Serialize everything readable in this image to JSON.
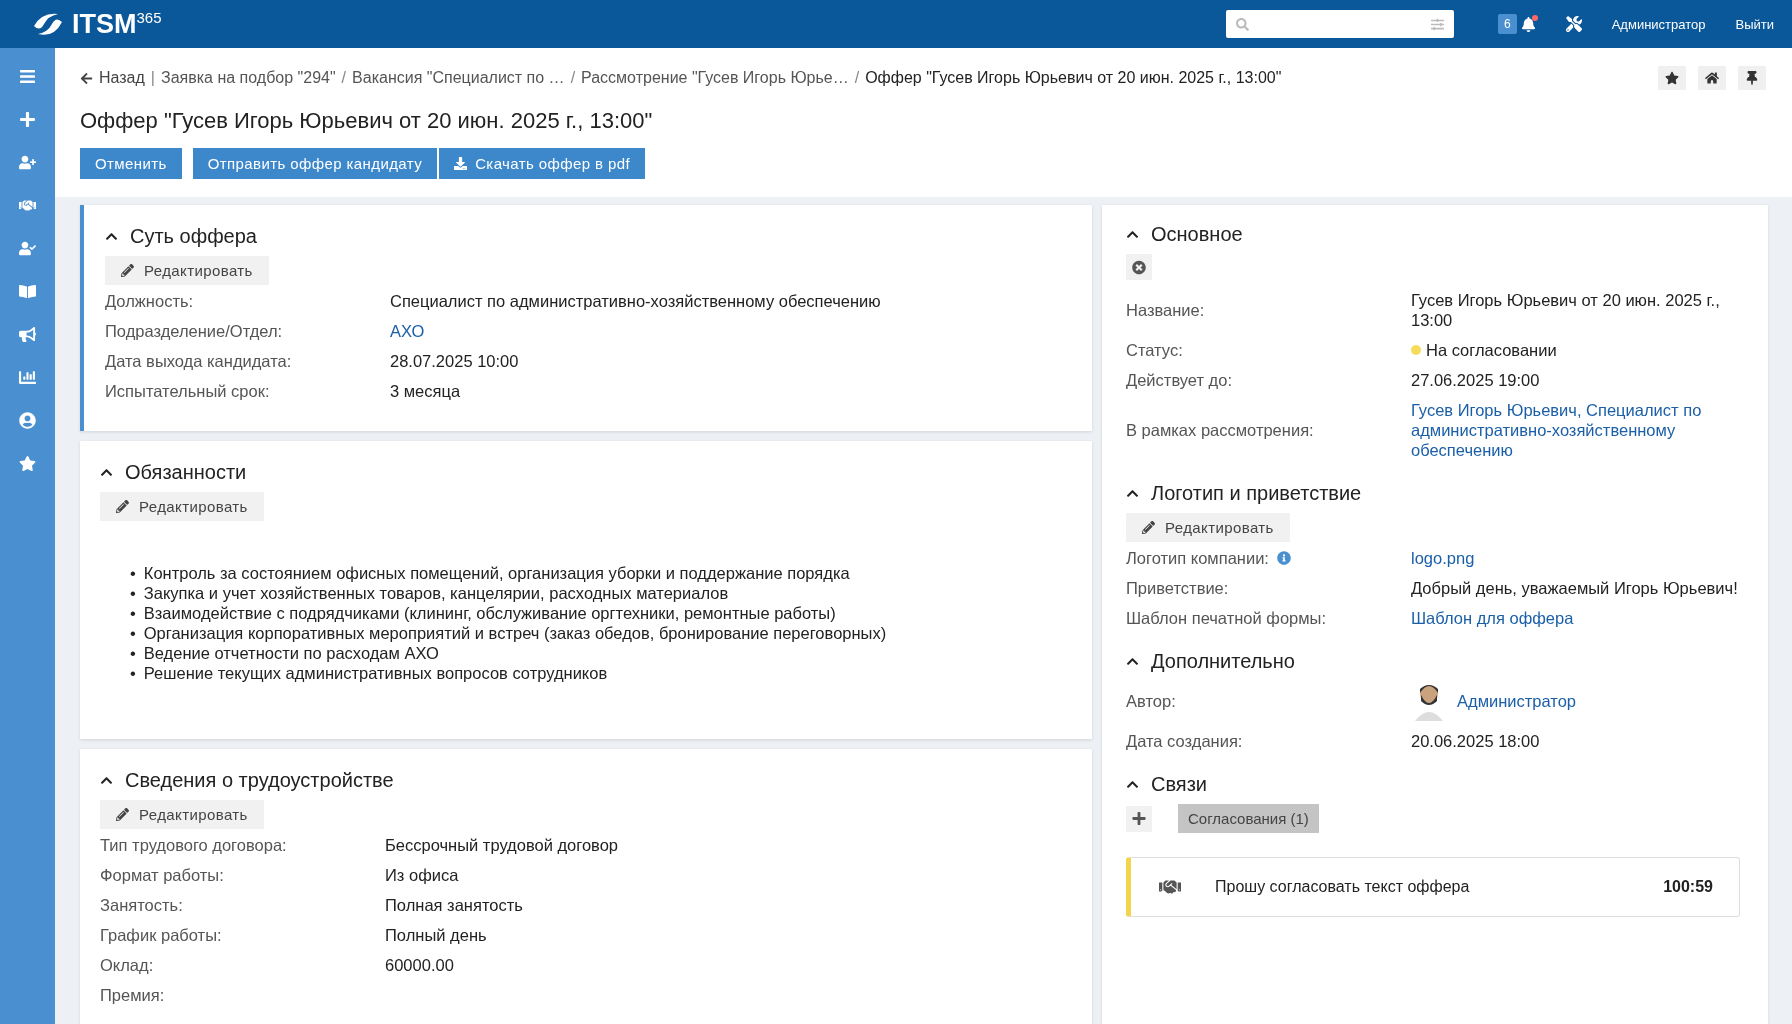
{
  "header": {
    "logo": "ITSM",
    "logo_sup": "365",
    "notifications": "6",
    "user": "Администратор",
    "logout": "Выйти"
  },
  "breadcrumbs": {
    "back": "Назад",
    "divider": "|",
    "separator": "/",
    "items": [
      "Заявка на подбор \"294\"",
      "Вакансия \"Специалист по …",
      "Рассмотрение \"Гусев Игорь Юрье…",
      "Оффер \"Гусев Игорь Юрьевич от 20 июн. 2025 г., 13:00\""
    ]
  },
  "title": "Оффер \"Гусев Игорь Юрьевич от 20 июн. 2025 г., 13:00\"",
  "actions": [
    {
      "label": "Отменить",
      "kind": "plain"
    },
    {
      "label": "Отправить оффер кандидату",
      "kind": "plain"
    },
    {
      "label": "Скачать оффер в pdf",
      "kind": "download"
    }
  ],
  "left_sections": [
    {
      "title": "Суть оффера",
      "active": true,
      "edit": "Редактировать",
      "fields": [
        {
          "label": "Должность:",
          "value": "Специалист по административно-хозяйственному обеспечению",
          "kind": "text"
        },
        {
          "label": "Подразделение/Отдел:",
          "value": "АХО",
          "kind": "link"
        },
        {
          "label": "Дата выхода кандидата:",
          "value": "28.07.2025 10:00",
          "kind": "text"
        },
        {
          "label": "Испытательный срок:",
          "value": "3 месяца",
          "kind": "text"
        }
      ]
    },
    {
      "title": "Обязанности",
      "active": false,
      "edit": "Редактировать",
      "bullet": "•",
      "bullets": [
        "Контроль за состоянием офисных помещений, организация уборки и поддержание порядка",
        "Закупка и учет хозяйственных товаров, канцелярии, расходных материалов",
        "Взаимодействие с подрядчиками (клининг, обслуживание оргтехники, ремонтные работы)",
        "Организация корпоративных мероприятий и встреч (заказ обедов, бронирование переговорных)",
        "Ведение отчетности по расходам АХО",
        "Решение текущих административных вопросов сотрудников"
      ]
    },
    {
      "title": "Сведения о трудоустройстве",
      "active": false,
      "edit": "Редактировать",
      "fields": [
        {
          "label": "Тип трудового договора:",
          "value": "Бессрочный трудовой договор",
          "kind": "text"
        },
        {
          "label": "Формат работы:",
          "value": "Из офиса",
          "kind": "text"
        },
        {
          "label": "Занятость:",
          "value": "Полная занятость",
          "kind": "text"
        },
        {
          "label": "График работы:",
          "value": "Полный день",
          "kind": "text"
        },
        {
          "label": "Оклад:",
          "value": "60000.00",
          "kind": "text"
        },
        {
          "label": "Премия:"
        }
      ]
    }
  ],
  "right_sections": [
    {
      "title": "Основное",
      "cancel_button": true,
      "fields": [
        {
          "label": "Название:",
          "value": "Гусев Игорь Юрьевич от 20 июн. 2025 г., 13:00",
          "kind": "text"
        },
        {
          "label": "Статус:",
          "value": "На согласовании",
          "kind": "status",
          "color": "#f7dc5c"
        },
        {
          "label": "Действует до:",
          "value": "27.06.2025 19:00",
          "kind": "text"
        },
        {
          "label": "В рамках рассмотрения:",
          "value": "Гусев Игорь Юрьевич, Специалист по административно-хозяйственному обеспечению",
          "kind": "link"
        }
      ]
    },
    {
      "title": "Логотип и приветствие",
      "edit": "Редактировать",
      "fields": [
        {
          "label": "Логотип компании:",
          "info": true,
          "value": "logo.png",
          "kind": "link"
        },
        {
          "label": "Приветствие:",
          "value": "Добрый день, уважаемый Игорь Юрьевич!",
          "kind": "text"
        },
        {
          "label": "Шаблон печатной формы:",
          "value": "Шаблон для оффера",
          "kind": "link"
        }
      ]
    },
    {
      "title": "Дополнительно",
      "fields": [
        {
          "label": "Автор:",
          "value": "Администратор",
          "kind": "person"
        },
        {
          "label": "Дата создания:",
          "value": "20.06.2025 18:00",
          "kind": "text"
        }
      ]
    },
    {
      "title": "Связи",
      "tabs": [
        {
          "label": "Согласования (1)",
          "selected": true
        }
      ],
      "tasks": [
        {
          "text": "Прошу согласовать текст оффера",
          "time": "100:59"
        }
      ]
    }
  ]
}
